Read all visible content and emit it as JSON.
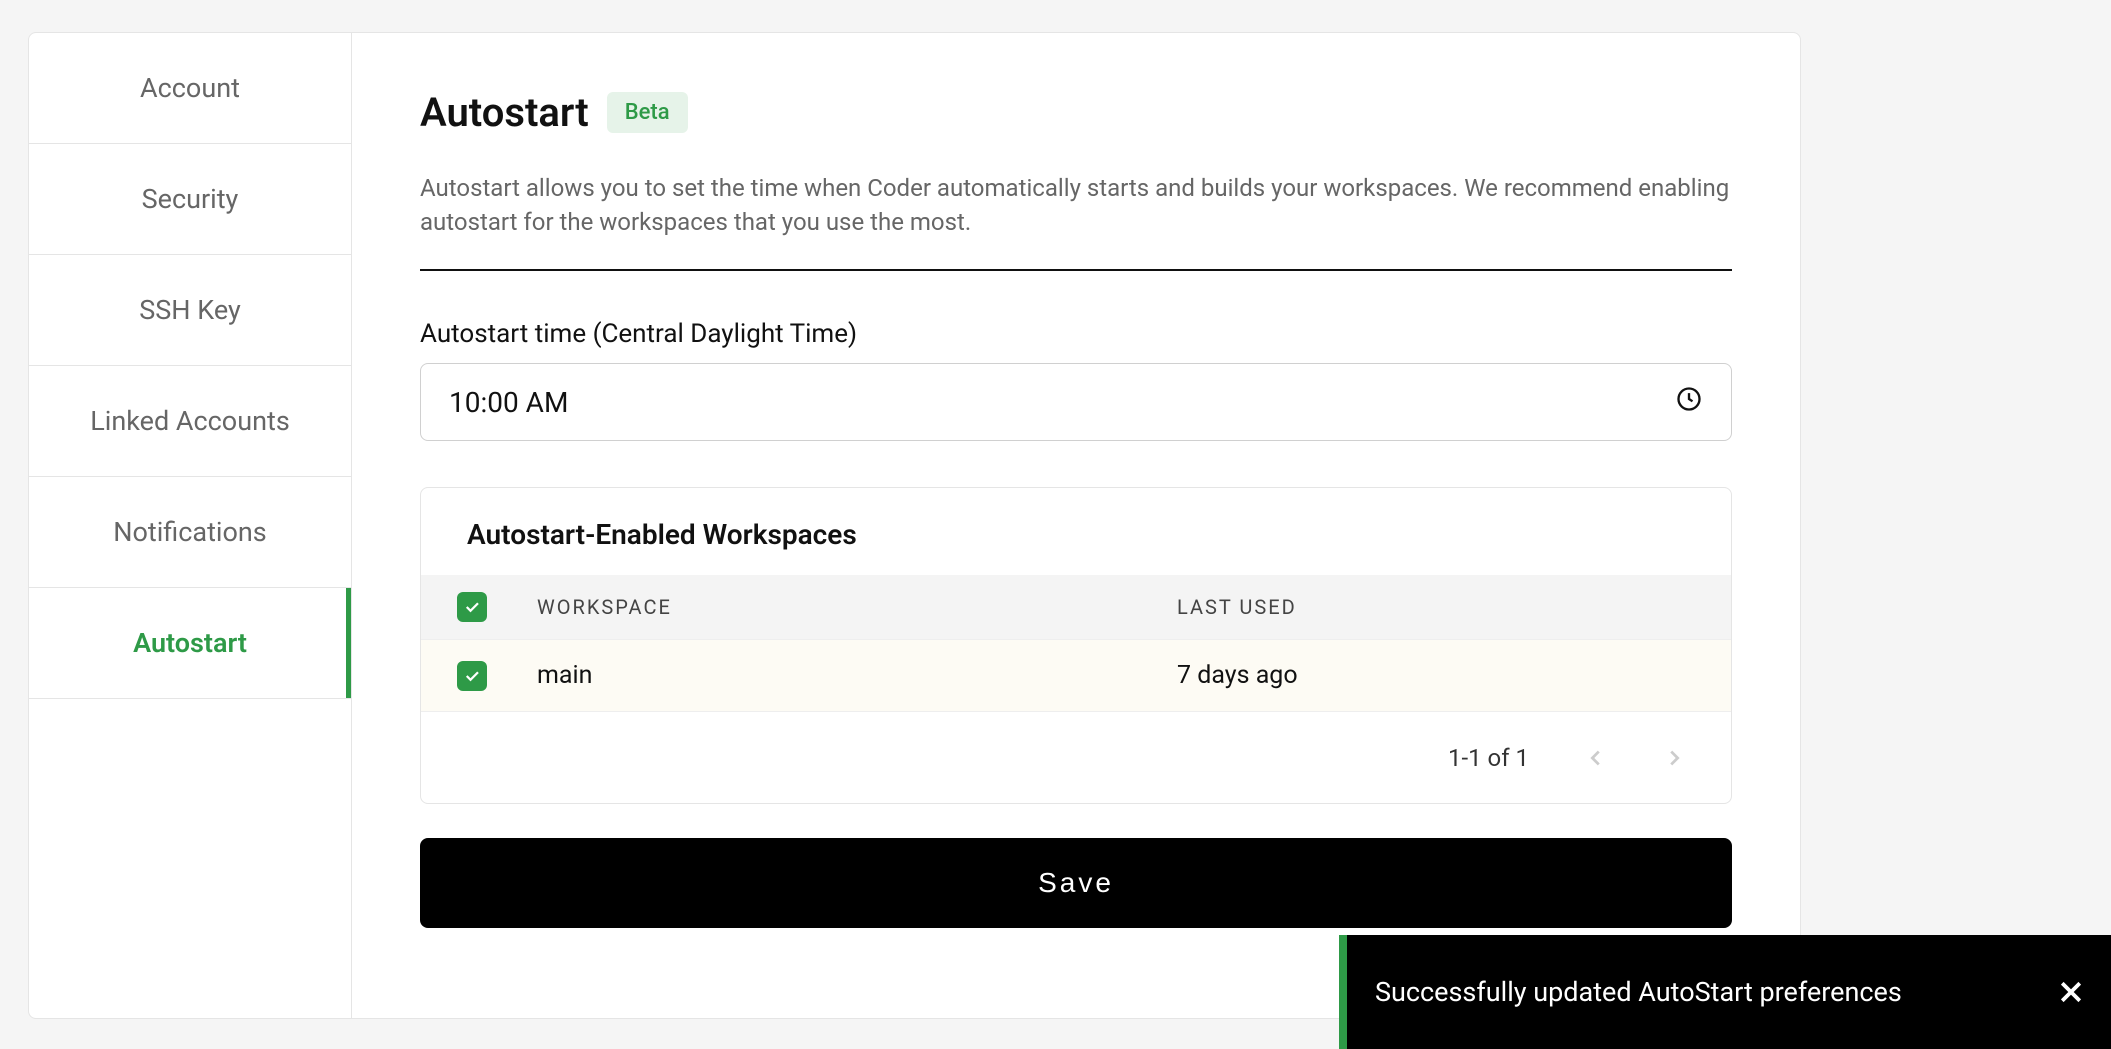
{
  "sidebar": {
    "items": [
      {
        "label": "Account"
      },
      {
        "label": "Security"
      },
      {
        "label": "SSH Key"
      },
      {
        "label": "Linked Accounts"
      },
      {
        "label": "Notifications"
      },
      {
        "label": "Autostart"
      }
    ],
    "active_index": 5
  },
  "header": {
    "title": "Autostart",
    "badge": "Beta",
    "description": "Autostart allows you to set the time when Coder automatically starts and builds your workspaces. We recommend enabling autostart for the workspaces that you use the most."
  },
  "time_field": {
    "label": "Autostart time (Central Daylight Time)",
    "value": "10:00 AM"
  },
  "workspaces_table": {
    "title": "Autostart-Enabled Workspaces",
    "columns": {
      "workspace": "WORKSPACE",
      "last_used": "LAST USED"
    },
    "rows": [
      {
        "checked": true,
        "name": "main",
        "last_used": "7 days ago"
      }
    ],
    "pagination": "1-1 of 1"
  },
  "save_button": "Save",
  "toast": {
    "message": "Successfully updated AutoStart preferences"
  }
}
